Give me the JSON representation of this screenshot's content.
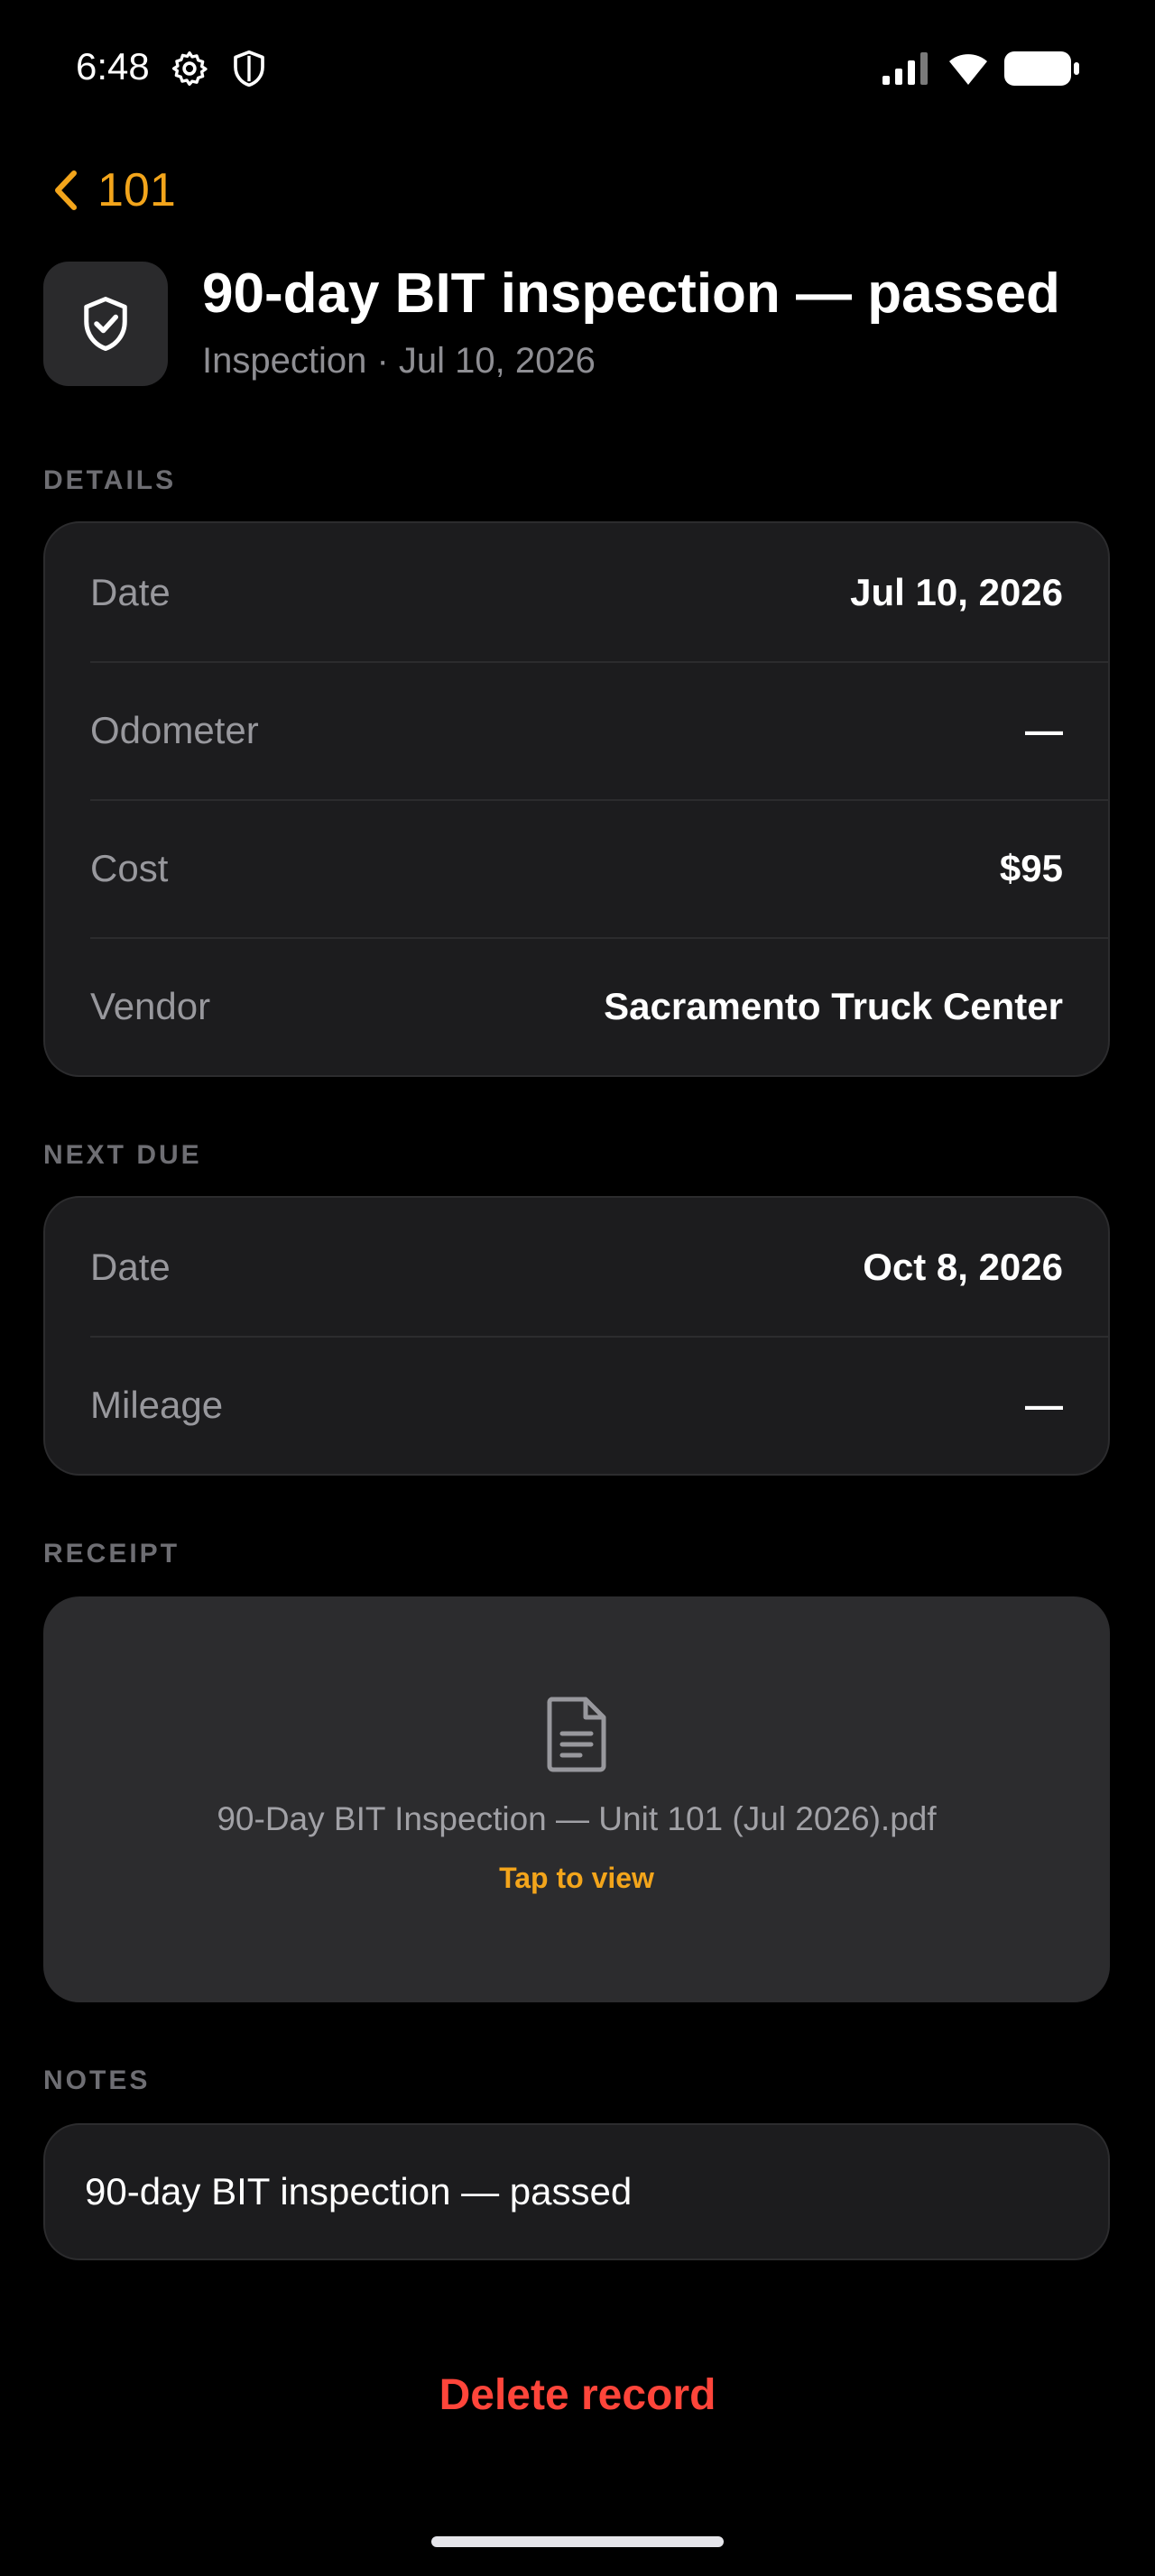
{
  "status_bar": {
    "time": "6:48",
    "icons": [
      "gear-icon",
      "shield-icon",
      "signal-icon",
      "wifi-icon",
      "battery-icon"
    ]
  },
  "nav": {
    "back_label": "101"
  },
  "header": {
    "icon": "shield-check-icon",
    "title": "90-day BIT inspection — passed",
    "subtitle": "Inspection · Jul 10, 2026"
  },
  "details": {
    "section_label": "DETAILS",
    "rows": [
      {
        "label": "Date",
        "value": "Jul 10, 2026"
      },
      {
        "label": "Odometer",
        "value": "—"
      },
      {
        "label": "Cost",
        "value": "$95"
      },
      {
        "label": "Vendor",
        "value": "Sacramento Truck Center"
      }
    ]
  },
  "next_due": {
    "section_label": "NEXT DUE",
    "rows": [
      {
        "label": "Date",
        "value": "Oct 8, 2026"
      },
      {
        "label": "Mileage",
        "value": "—"
      }
    ]
  },
  "receipt": {
    "section_label": "RECEIPT",
    "icon": "document-icon",
    "file_name": "90-Day BIT Inspection — Unit 101 (Jul 2026).pdf",
    "action": "Tap to view"
  },
  "notes": {
    "section_label": "NOTES",
    "text": "90-day BIT inspection — passed"
  },
  "delete_label": "Delete record",
  "colors": {
    "accent": "#f3a51b",
    "danger": "#ff453a",
    "background": "#000000",
    "card": "#1c1c1e"
  }
}
